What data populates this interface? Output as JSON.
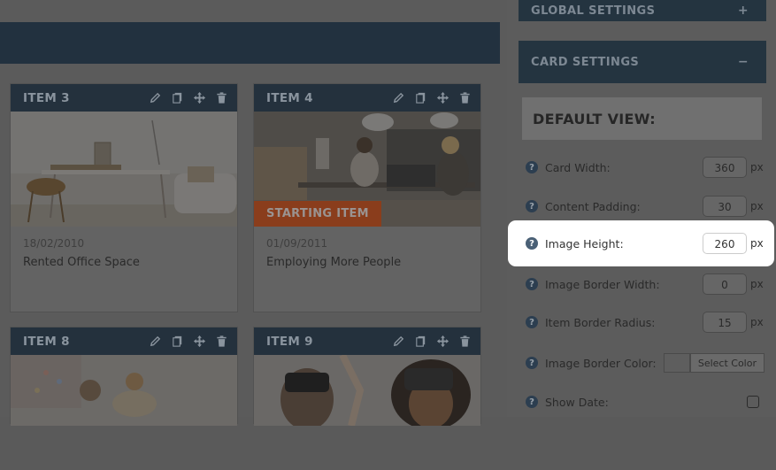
{
  "sidebar": {
    "global_settings": {
      "title": "GLOBAL SETTINGS",
      "toggle": "+"
    },
    "card_settings": {
      "title": "CARD SETTINGS",
      "toggle": "−"
    },
    "default_view": "DEFAULT VIEW:",
    "fields": [
      {
        "label": "Card Width:",
        "value": "360",
        "unit": "px"
      },
      {
        "label": "Content Padding:",
        "value": "30",
        "unit": "px"
      },
      {
        "label": "Image Height:",
        "value": "260",
        "unit": "px"
      },
      {
        "label": "Image Border Width:",
        "value": "0",
        "unit": "px"
      },
      {
        "label": "Item Border Radius:",
        "value": "15",
        "unit": "px"
      },
      {
        "label": "Image Border Color:",
        "button": "Select Color"
      },
      {
        "label": "Show Date:",
        "checked": false
      }
    ]
  },
  "cards": [
    {
      "title": "ITEM 3",
      "date": "18/02/2010",
      "text": "Rented Office Space"
    },
    {
      "title": "ITEM 4",
      "date": "01/09/2011",
      "text": "Employing More People",
      "badge": "STARTING ITEM"
    },
    {
      "title": "ITEM 8"
    },
    {
      "title": "ITEM 9"
    }
  ],
  "icons": [
    "pencil-icon",
    "copy-icon",
    "move-icon",
    "trash-icon",
    "help-icon"
  ]
}
